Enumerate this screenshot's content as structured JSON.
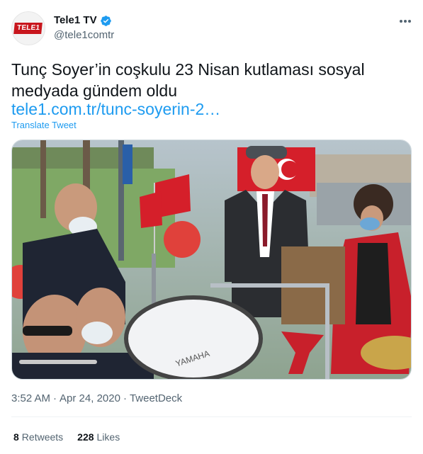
{
  "tweet": {
    "avatar_logo": "TELE1",
    "display_name": "Tele1 TV",
    "handle": "@tele1comtr",
    "text": "Tunç Soyer’in coşkulu 23 Nisan kutlaması sosyal medyada gündem oldu",
    "link": "tele1.com.tr/tunc-soyerin-2…",
    "translate_label": "Translate Tweet",
    "time": "3:52 AM",
    "separator": "·",
    "date": "Apr 24, 2020",
    "source": "TweetDeck",
    "retweets_count": "8",
    "retweets_label": "Retweets",
    "likes_count": "228",
    "likes_label": "Likes",
    "drum_brand": "YAMAHA"
  },
  "colors": {
    "link": "#1d9bf0",
    "verified": "#1d9bf0",
    "secondary_text": "#536471",
    "brand_red": "#c8161d"
  },
  "icons": {
    "verified": "verified-badge-icon",
    "more": "more-horizontal-icon"
  }
}
